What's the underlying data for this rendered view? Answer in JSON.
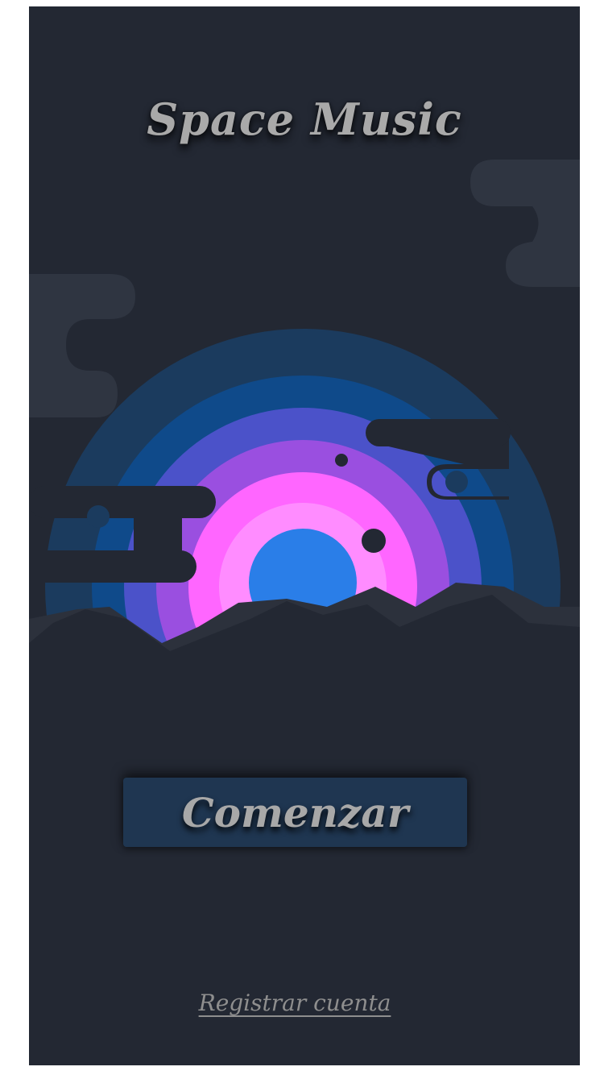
{
  "app": {
    "title": "Space Music"
  },
  "actions": {
    "start_label": "Comenzar",
    "register_label": "Registrar cuenta"
  },
  "illustration": {
    "icon": "planet-sunset-illustration",
    "colors": {
      "background": "#232833",
      "cloud": "#2f3541",
      "ring_outer": "#1b3b5e",
      "ring_2": "#0f4a8a",
      "ring_3": "#4b52c9",
      "ring_4": "#9a4fe0",
      "ring_5": "#ff66ff",
      "ring_6": "#ff8cff",
      "core": "#2a7ee8",
      "mountain": "#2c313c"
    }
  }
}
